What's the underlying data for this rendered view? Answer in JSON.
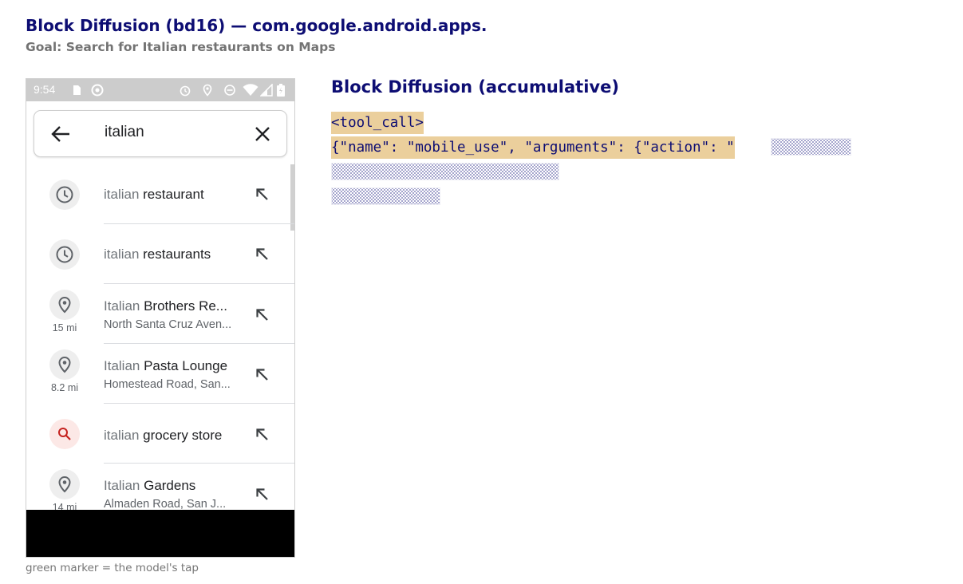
{
  "header": {
    "title": "Block Diffusion (bd16) — com.google.android.apps.",
    "goal": "Goal: Search for Italian restaurants on Maps"
  },
  "phone": {
    "status_time": "9:54",
    "status_icons": [
      "sd-card-icon",
      "circle-sync-icon",
      "alarm-icon",
      "location-icon",
      "dnd-icon",
      "wifi-icon",
      "signal-icon",
      "battery-icon"
    ],
    "search_query": "italian",
    "suggestions": [
      {
        "icon": "history-icon",
        "query_part": "italian",
        "rest": " restaurant",
        "subtitle": "",
        "distance": ""
      },
      {
        "icon": "history-icon",
        "query_part": "italian",
        "rest": " restaurants",
        "subtitle": "",
        "distance": ""
      },
      {
        "icon": "location-pin-icon",
        "query_part": "Italian",
        "rest": " Brothers Re...",
        "subtitle": "North Santa Cruz Aven...",
        "distance": "15 mi"
      },
      {
        "icon": "location-pin-icon",
        "query_part": "Italian",
        "rest": " Pasta Lounge",
        "subtitle": "Homestead Road, San...",
        "distance": "8.2 mi"
      },
      {
        "icon": "search-icon",
        "query_part": "italian",
        "rest": " grocery store",
        "subtitle": "",
        "distance": ""
      },
      {
        "icon": "location-pin-icon",
        "query_part": "Italian",
        "rest": " Gardens",
        "subtitle": "Almaden Road, San J...",
        "distance": "14 mi"
      }
    ]
  },
  "caption": "green marker = the model's tap",
  "panel": {
    "title": "Block Diffusion (accumulative)",
    "line1": "<tool_call>",
    "line2": "{\"name\": \"mobile_use\", \"arguments\": {\"action\": \""
  },
  "colors": {
    "title": "#0d0d73",
    "highlight": "#ebcf9c",
    "hatch": "#8c8cbf"
  }
}
